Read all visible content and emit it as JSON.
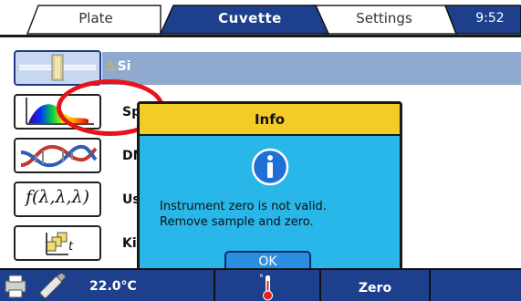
{
  "tabs": [
    {
      "label": "Plate",
      "active": false
    },
    {
      "label": "Cuvette",
      "active": true
    },
    {
      "label": "Settings",
      "active": false
    }
  ],
  "clock": "9:52",
  "apps": [
    {
      "id": "simple",
      "label": "Si",
      "icon": "cuvette-beam-icon",
      "warning": true,
      "selected": true
    },
    {
      "id": "spectrum",
      "label": "Sp",
      "icon": "spectrum-icon"
    },
    {
      "id": "dna",
      "label": "DN",
      "icon": "dna-icon"
    },
    {
      "id": "userfn",
      "label": "Us",
      "icon": "user-function-icon",
      "icon_text": "f(λ,λ,λ)"
    },
    {
      "id": "kinetics",
      "label": "Ki",
      "icon": "kinetics-icon",
      "icon_text": "t"
    }
  ],
  "warning_glyph": "⚠",
  "dialog": {
    "title": "Info",
    "icon": "info-icon",
    "message_line1": "Instrument zero is not valid.",
    "message_line2": "Remove sample and zero.",
    "ok_label": "OK"
  },
  "statusbar": {
    "temperature": "22.0°C",
    "zero_label": "Zero",
    "thermo_icon": "thermometer-icon"
  },
  "colors": {
    "accent": "#1d3f8c",
    "dialog_bg": "#29b6e8",
    "dialog_title_bg": "#f4cc28",
    "annotation": "#e8131a"
  }
}
